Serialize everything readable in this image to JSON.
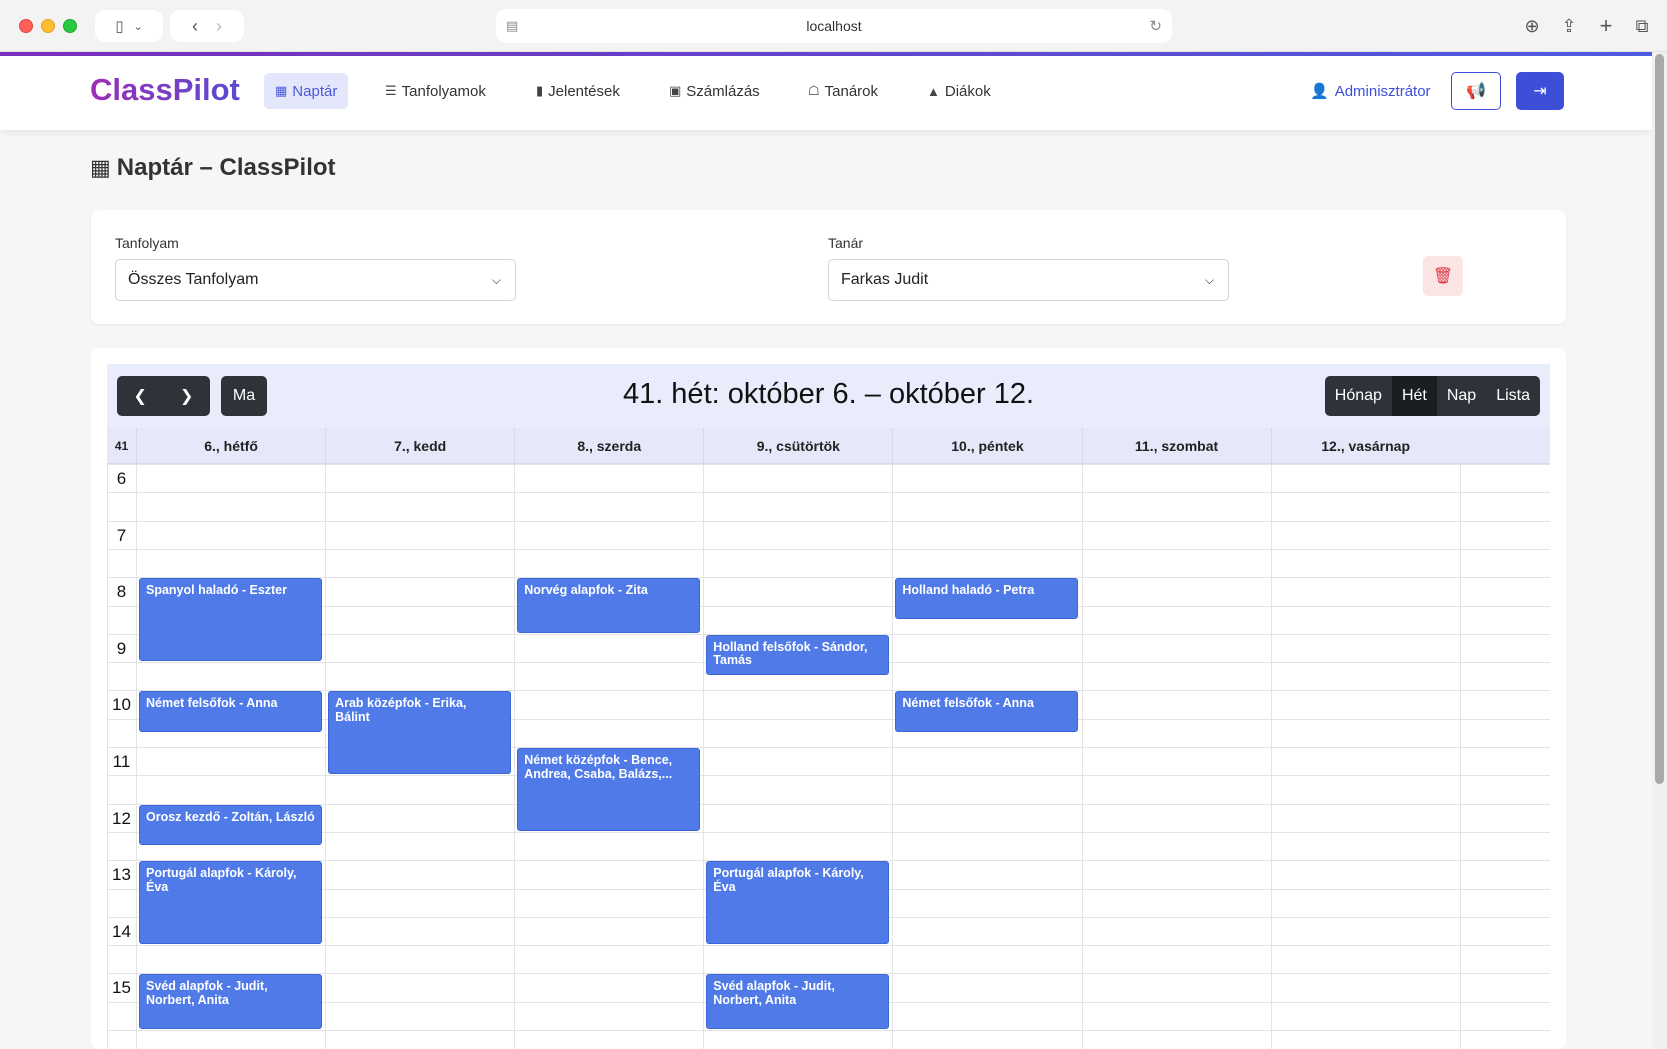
{
  "browser": {
    "url": "localhost"
  },
  "navbar": {
    "brand": "ClassPilot",
    "items": [
      {
        "label": "Naptár",
        "icon": "calendar-icon",
        "active": true
      },
      {
        "label": "Tanfolyamok",
        "icon": "list-icon",
        "active": false
      },
      {
        "label": "Jelentések",
        "icon": "file-icon",
        "active": false
      },
      {
        "label": "Számlázás",
        "icon": "money-icon",
        "active": false
      },
      {
        "label": "Tanárok",
        "icon": "teacher-icon",
        "active": false
      },
      {
        "label": "Diákok",
        "icon": "graduation-cap-icon",
        "active": false
      }
    ],
    "user": "Adminisztrátor",
    "accent": "#3d4fd9"
  },
  "page": {
    "title": "Naptár – ClassPilot"
  },
  "filters": {
    "course_label": "Tanfolyam",
    "course_value": "Összes Tanfolyam",
    "teacher_label": "Tanár",
    "teacher_value": "Farkas Judit"
  },
  "calendar": {
    "title": "41. hét: október 6. – október 12.",
    "today": "Ma",
    "views": [
      "Hónap",
      "Hét",
      "Nap",
      "Lista"
    ],
    "active_view": "Hét",
    "week_number": "41",
    "days": [
      "6., hétfő",
      "7., kedd",
      "8., szerda",
      "9., csütörtök",
      "10., péntek",
      "11., szombat",
      "12., vasárnap"
    ],
    "hours": [
      "6",
      "7",
      "8",
      "9",
      "10",
      "11",
      "12",
      "13",
      "14",
      "15"
    ],
    "event_color": "#4f7ae8",
    "events": [
      {
        "day": 0,
        "start": 8,
        "end": 9.5,
        "title": "Spanyol haladó - Eszter"
      },
      {
        "day": 2,
        "start": 8,
        "end": 9,
        "title": "Norvég alapfok - Zita"
      },
      {
        "day": 4,
        "start": 8,
        "end": 8.75,
        "title": "Holland haladó - Petra"
      },
      {
        "day": 3,
        "start": 9,
        "end": 9.75,
        "title": "Holland felsőfok - Sándor, Tamás"
      },
      {
        "day": 0,
        "start": 10,
        "end": 10.75,
        "title": "Német felsőfok - Anna"
      },
      {
        "day": 1,
        "start": 10,
        "end": 11.5,
        "title": "Arab középfok - Erika, Bálint"
      },
      {
        "day": 4,
        "start": 10,
        "end": 10.75,
        "title": "Német felsőfok - Anna"
      },
      {
        "day": 2,
        "start": 11,
        "end": 12.5,
        "title": "Német középfok - Bence, Andrea, Csaba, Balázs,..."
      },
      {
        "day": 0,
        "start": 12,
        "end": 12.75,
        "title": "Orosz kezdő - Zoltán, László"
      },
      {
        "day": 0,
        "start": 13,
        "end": 14.5,
        "title": "Portugál alapfok - Károly, Éva"
      },
      {
        "day": 3,
        "start": 13,
        "end": 14.5,
        "title": "Portugál alapfok - Károly, Éva"
      },
      {
        "day": 0,
        "start": 15,
        "end": 16,
        "title": "Svéd alapfok - Judit, Norbert, Anita"
      },
      {
        "day": 3,
        "start": 15,
        "end": 16,
        "title": "Svéd alapfok - Judit, Norbert, Anita"
      }
    ]
  }
}
